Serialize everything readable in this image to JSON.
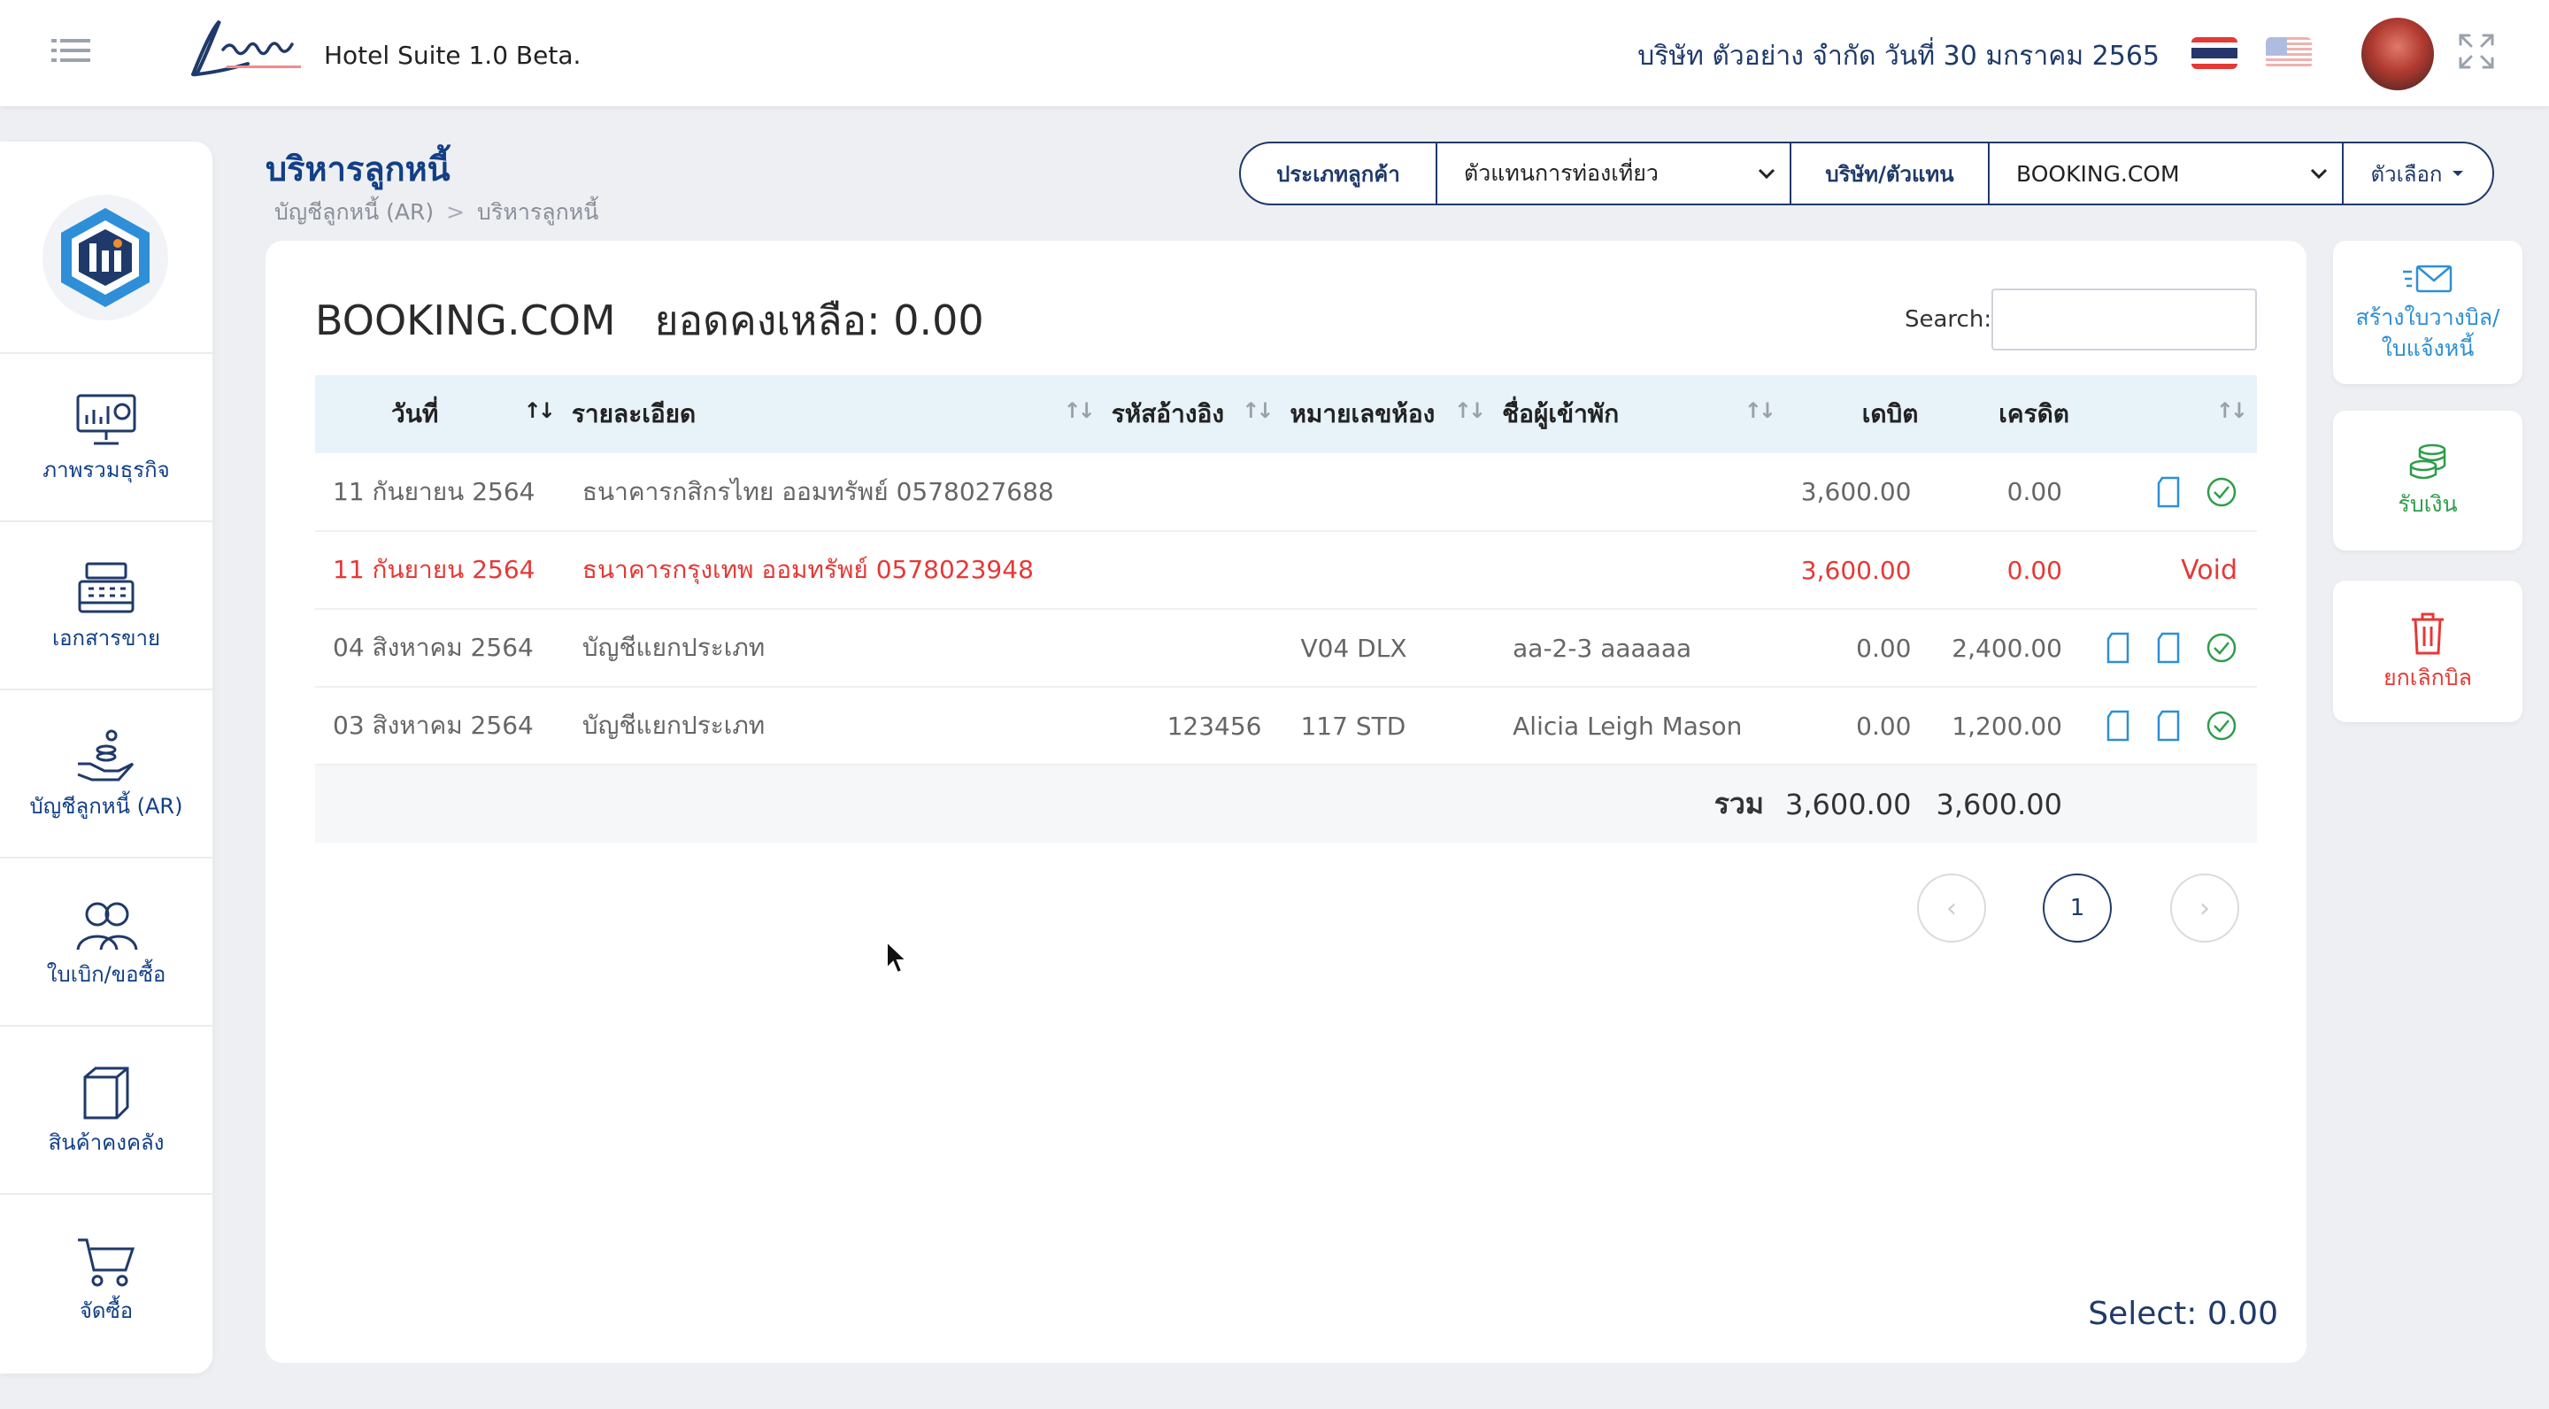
{
  "header": {
    "app_title": "Hotel Suite 1.0 Beta.",
    "company_date": "บริษัท ตัวอย่าง จำกัด  วันที่ 30 มกราคม 2565"
  },
  "sidebar": {
    "items": [
      {
        "label": "ภาพรวมธุรกิจ",
        "icon": "dashboard-monitor-icon"
      },
      {
        "label": "เอกสารขาย",
        "icon": "cash-register-icon"
      },
      {
        "label": "บัญชีลูกหนี้ (AR)",
        "icon": "hand-coins-icon"
      },
      {
        "label": "ใบเบิก/ขอซื้อ",
        "icon": "users-icon"
      },
      {
        "label": "สินค้าคงคลัง",
        "icon": "box-icon"
      },
      {
        "label": "จัดซื้อ",
        "icon": "cart-icon"
      }
    ]
  },
  "page": {
    "title": "บริหารลูกหนี้",
    "breadcrumb": [
      "บัญชีลูกหนี้ (AR)",
      "บริหารลูกหนี้"
    ]
  },
  "filters": {
    "customer_type_label": "ประเภทลูกค้า",
    "customer_type_value": "ตัวแทนการท่องเที่ยว",
    "agent_label": "บริษัท/ตัวแทน",
    "agent_value": "BOOKING.COM",
    "options_label": "ตัวเลือก"
  },
  "card": {
    "name": "BOOKING.COM",
    "balance": "ยอดคงเหลือ: 0.00",
    "search_label": "Search:",
    "search_value": ""
  },
  "table": {
    "columns": [
      "วันที่",
      "รายละเอียด",
      "รหัสอ้างอิง",
      "หมายเลขห้อง",
      "ชื่อผู้เข้าพัก",
      "เดบิต",
      "เครดิต"
    ],
    "rows": [
      {
        "date": "11 กันยายน 2564",
        "detail": "ธนาคารกสิกรไทย ออมทรัพย์ 0578027688",
        "ref": "",
        "room": "",
        "guest": "",
        "debit": "3,600.00",
        "credit": "0.00",
        "status": ""
      },
      {
        "date": "11 กันยายน 2564",
        "detail": "ธนาคารกรุงเทพ ออมทรัพย์ 0578023948",
        "ref": "",
        "room": "",
        "guest": "",
        "debit": "3,600.00",
        "credit": "0.00",
        "status": "Void"
      },
      {
        "date": "04 สิงหาคม 2564",
        "detail": "บัญชีแยกประเภท",
        "ref": "",
        "room": "V04 DLX",
        "guest": "aa-2-3 aaaaaa",
        "debit": "0.00",
        "credit": "2,400.00",
        "status": ""
      },
      {
        "date": "03 สิงหาคม 2564",
        "detail": "บัญชีแยกประเภท",
        "ref": "123456",
        "room": "117 STD",
        "guest": "Alicia Leigh Mason",
        "debit": "0.00",
        "credit": "1,200.00",
        "status": ""
      }
    ],
    "total_label": "รวม",
    "total_debit": "3,600.00",
    "total_credit": "3,600.00"
  },
  "pagination": {
    "prev": "‹",
    "current": "1",
    "next": "›"
  },
  "select_total": "Select: 0.00",
  "right_actions": [
    {
      "label": "สร้างใบวางบิล/ใบแจ้งหนี้",
      "color": "#2d8fd5",
      "icon": "invoice-mail-icon"
    },
    {
      "label": "รับเงิน",
      "color": "#2e9d4a",
      "icon": "coins-stack-icon"
    },
    {
      "label": "ยกเลิกบิล",
      "color": "#e53935",
      "icon": "trash-icon"
    }
  ],
  "colors": {
    "primary": "#1f3a6a",
    "accent_blue": "#2d8fd5",
    "success": "#2e9d4a",
    "danger": "#e53935",
    "table_header_bg": "#e8f2f9"
  }
}
